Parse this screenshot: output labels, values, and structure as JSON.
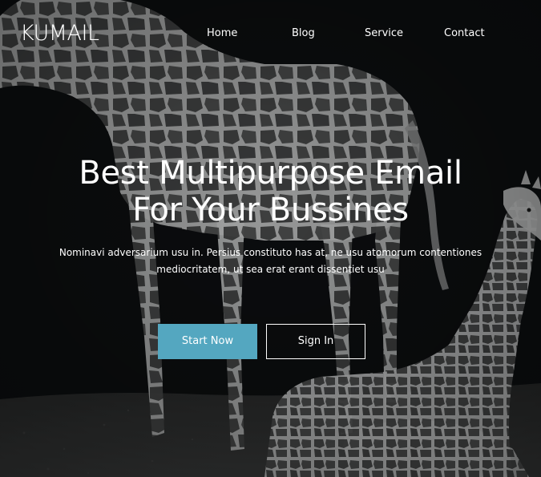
{
  "brand": {
    "logo": "KUMAIL"
  },
  "nav": {
    "items": [
      "Home",
      "Blog",
      "Service",
      "Contact"
    ]
  },
  "hero": {
    "headline_line1": "Best Multipurpose Email",
    "headline_line2": "For Your Bussines",
    "subtext_line1": "Nominavi adversarium usu in. Persius constituto has at, ne usu atomorum contentiones",
    "subtext_line2": "mediocritatem, ut sea erat erant dissentiet usu",
    "background_image": "giraffe-photo",
    "cta": {
      "primary_label": "Start Now",
      "secondary_label": "Sign In"
    }
  },
  "colors": {
    "accent": "#54a7c0",
    "text": "#ffffff",
    "background": "#0b0c0e"
  }
}
